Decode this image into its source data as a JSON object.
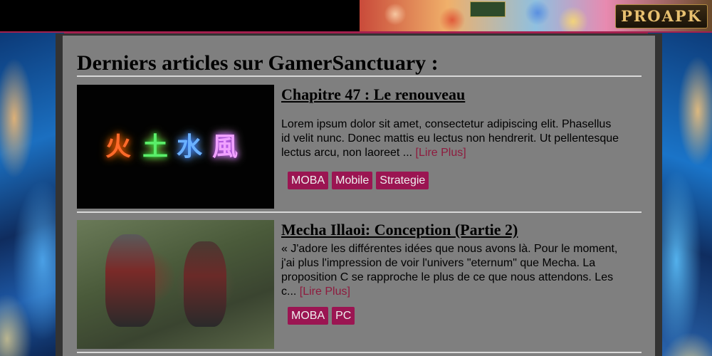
{
  "header": {
    "banner_logo": "PROAPK"
  },
  "section": {
    "title": "Derniers articles sur GamerSanctuary :"
  },
  "articles": [
    {
      "title": "Chapitre 47 : Le renouveau",
      "thumbnail_glyphs": [
        "火",
        "土",
        "水",
        "風"
      ],
      "excerpt": "Lorem ipsum dolor sit amet, consectetur adipiscing elit. Phasellus id velit nunc. Donec mattis eu lectus non hendrerit. Ut pellentesque lectus arcu, non laoreet ... ",
      "read_more": "[Lire Plus]",
      "tags": [
        "MOBA",
        "Mobile",
        "Strategie"
      ]
    },
    {
      "title": "Mecha Illaoi: Conception (Partie 2)",
      "excerpt": "« J'adore les différentes idées que nous avons là. Pour le moment, j'ai plus l'impression de voir l'univers \"eternum\" que Mecha. La proposition C se rapproche le plus de ce que nous attendons. Les c... ",
      "read_more": "[Lire Plus]",
      "tags": [
        "MOBA",
        "PC"
      ]
    }
  ],
  "colors": {
    "accent": "#a3204e",
    "tag_bg": "#9b1552",
    "read_more": "#8e1b3e",
    "panel_bg": "#7f7f7f"
  }
}
